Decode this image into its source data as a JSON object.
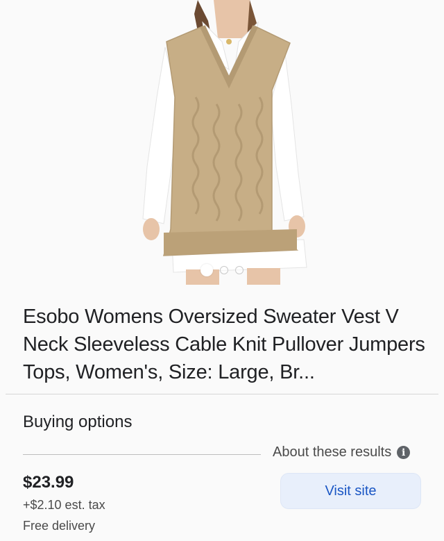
{
  "product": {
    "title": "Esobo Womens Oversized Sweater Vest V Neck Sleeveless Cable Knit Pullover Jumpers Tops, Women's, Size: Large, Br...",
    "image_count": 3,
    "active_image": 1
  },
  "buying": {
    "heading": "Buying options",
    "about_label": "About these results",
    "price": "$23.99",
    "tax": "+$2.10 est. tax",
    "delivery": "Free delivery",
    "visit_label": "Visit site"
  },
  "colors": {
    "accent": "#1a56c4",
    "button_bg": "#e8effb",
    "sweater": "#c7ae86"
  },
  "icons": {
    "info": "info-icon"
  }
}
